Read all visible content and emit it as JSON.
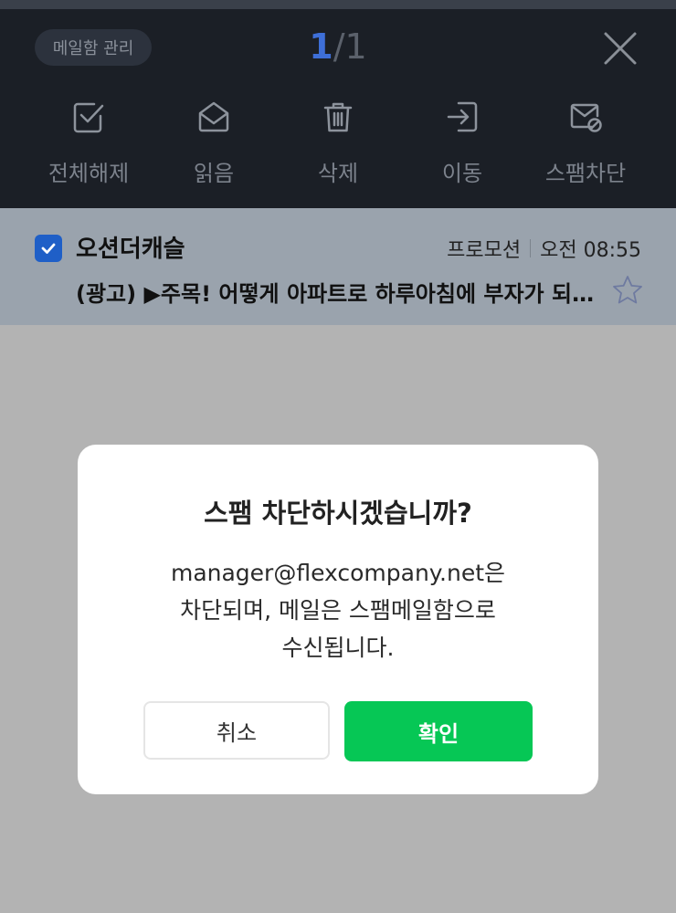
{
  "header": {
    "manage_label": "메일함 관리",
    "current_index": "1",
    "separator": "/",
    "total_count": "1"
  },
  "actions": [
    {
      "label": "전체해제",
      "icon": "check-square-icon"
    },
    {
      "label": "읽음",
      "icon": "open-envelope-icon"
    },
    {
      "label": "삭제",
      "icon": "trash-icon"
    },
    {
      "label": "이동",
      "icon": "move-icon"
    },
    {
      "label": "스팸차단",
      "icon": "spam-block-icon"
    }
  ],
  "mail": {
    "sender": "오션더캐슬",
    "category": "프로모션",
    "time": "오전 08:55",
    "subject": "(광고) ▶주목! 어떻게 아파트로 하루아침에 부자가 되었을까",
    "checked": true
  },
  "dialog": {
    "title": "스팸 차단하시겠습니까?",
    "line1": "manager@flexcompany.net은",
    "line2": "차단되며, 메일은 스팸메일함으로",
    "line3": "수신됩니다.",
    "cancel_label": "취소",
    "confirm_label": "확인"
  },
  "colors": {
    "header_bg": "#1b1f26",
    "selected_row_bg": "#9aa3ad",
    "overlay_bg": "#b3b3b3",
    "checkbox_blue": "#1f5fc7",
    "confirm_green": "#06c755"
  }
}
